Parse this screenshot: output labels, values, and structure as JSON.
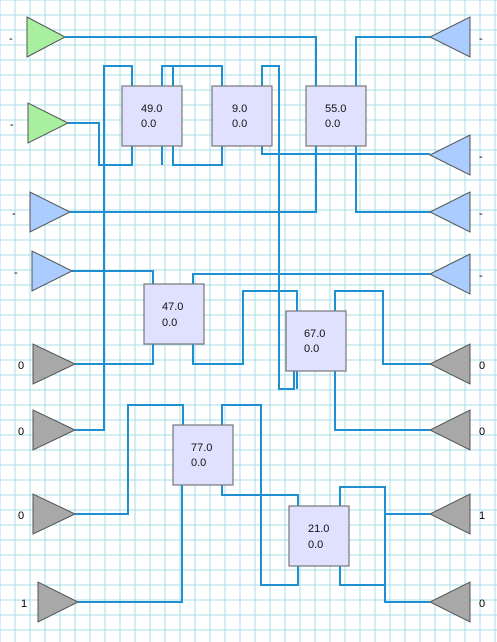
{
  "colors": {
    "grid_line": "#a8dcea",
    "background": "#ffffff",
    "wire": "#1e90d2",
    "node_fill": "#e0e0ff",
    "node_border": "#777777",
    "input_active": "#a8f0a0",
    "input_neutral": "#aaccff",
    "input_off": "#a8a8a8"
  },
  "inputs": [
    {
      "label": "-",
      "state": "active"
    },
    {
      "label": "-",
      "state": "active"
    },
    {
      "label": "-",
      "state": "neutral"
    },
    {
      "label": "-",
      "state": "neutral"
    },
    {
      "label": "0",
      "state": "off"
    },
    {
      "label": "0",
      "state": "off"
    },
    {
      "label": "0",
      "state": "off"
    },
    {
      "label": "1",
      "state": "off"
    }
  ],
  "outputs": [
    {
      "label": "-",
      "state": "neutral"
    },
    {
      "label": "-",
      "state": "neutral"
    },
    {
      "label": "-",
      "state": "neutral"
    },
    {
      "label": "-",
      "state": "neutral"
    },
    {
      "label": "0",
      "state": "off"
    },
    {
      "label": "0",
      "state": "off"
    },
    {
      "label": "1",
      "state": "off"
    },
    {
      "label": "0",
      "state": "off"
    }
  ],
  "nodes": [
    {
      "value": "49.0",
      "sub": "0.0"
    },
    {
      "value": "9.0",
      "sub": "0.0"
    },
    {
      "value": "55.0",
      "sub": "0.0"
    },
    {
      "value": "47.0",
      "sub": "0.0"
    },
    {
      "value": "67.0",
      "sub": "0.0"
    },
    {
      "value": "77.0",
      "sub": "0.0"
    },
    {
      "value": "21.0",
      "sub": "0.0"
    }
  ]
}
